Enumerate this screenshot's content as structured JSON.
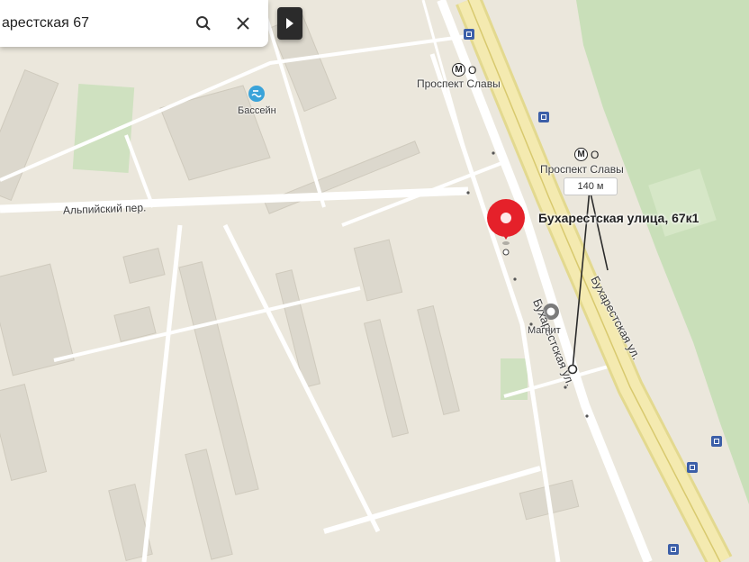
{
  "search": {
    "value": "арестская 67",
    "search_icon": "search-icon",
    "close_icon": "close-icon"
  },
  "route_button": {
    "icon": "route-icon"
  },
  "map": {
    "colors": {
      "background": "#ebe7dc",
      "park": "#c9dfb9",
      "road": "#ffffff",
      "major_road": "#f3e7a6",
      "building": "#dcd8cd",
      "pin": "#e5212a"
    },
    "streets": {
      "left_street": "Альпийский пер.",
      "bucharest_1": "Бухарестская ул.",
      "bucharest_2": "Бухарестская ул."
    },
    "metro": [
      {
        "symbol": "М",
        "extra": "О",
        "name": "Проспект Славы"
      },
      {
        "symbol": "М",
        "extra": "О",
        "name": "Проспект Славы"
      }
    ],
    "poi": {
      "pool_label": "Бассейн",
      "store_label": "Магнит"
    },
    "marker": {
      "icon": "location-pin-icon",
      "address": "Бухарестская улица, 67к1"
    },
    "distance": "140 м"
  }
}
